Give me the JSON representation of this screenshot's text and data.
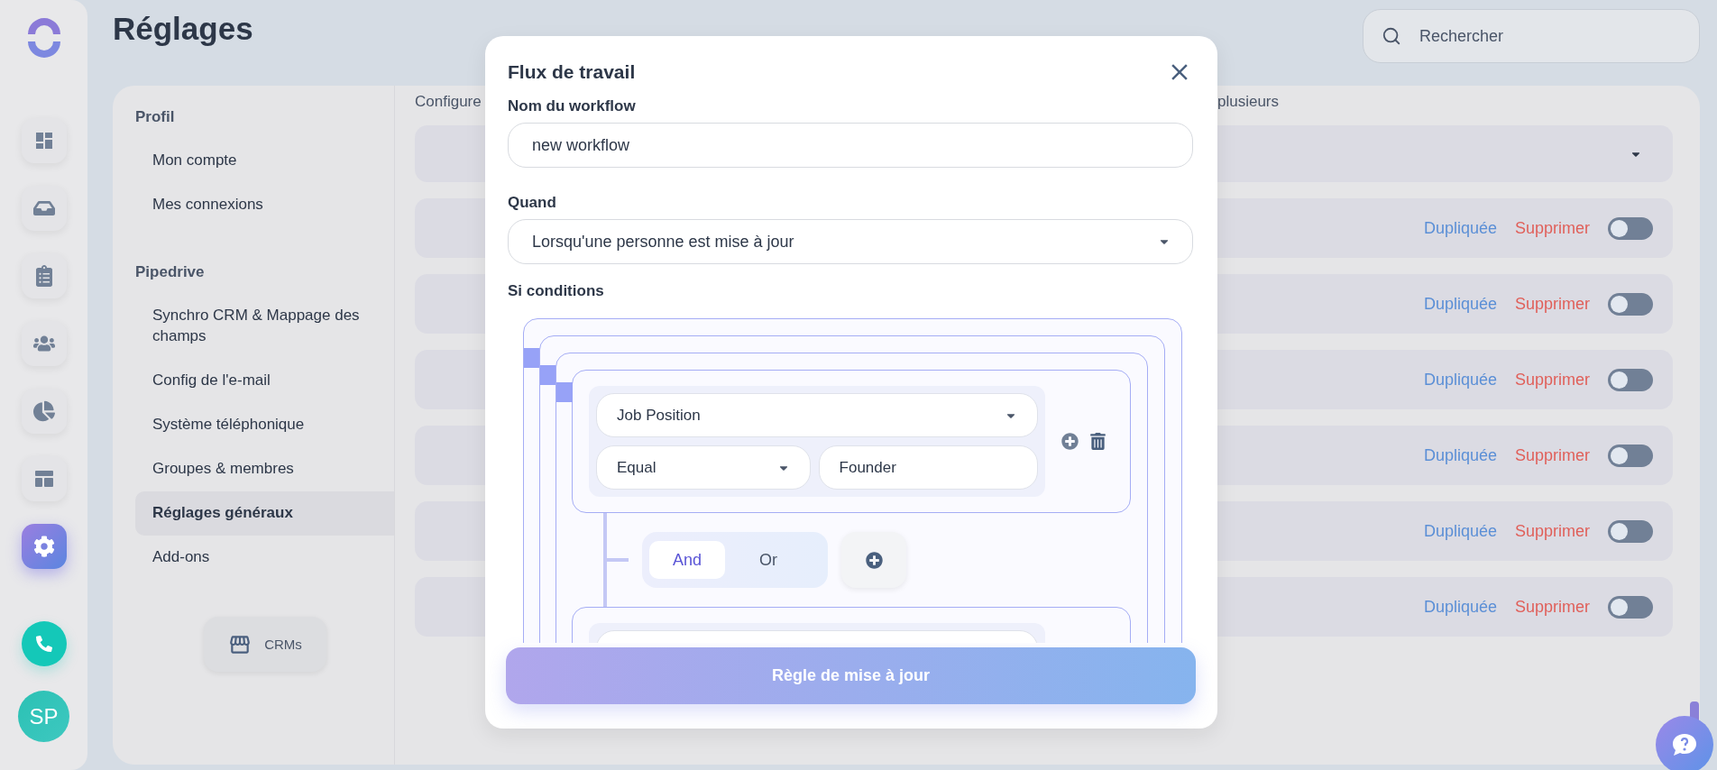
{
  "nav_rail": {
    "items": [
      {
        "selected": false
      },
      {
        "selected": false
      },
      {
        "selected": false
      },
      {
        "selected": false
      },
      {
        "selected": false
      },
      {
        "selected": false
      },
      {
        "selected": true
      }
    ],
    "avatar": "SP"
  },
  "page_title": "Réglages",
  "search": {
    "placeholder": "Rechercher"
  },
  "settings_nav": {
    "sections": [
      {
        "title": "Profil",
        "items": [
          {
            "label": "Mon compte",
            "selected": false
          },
          {
            "label": "Mes connexions",
            "selected": false
          }
        ]
      },
      {
        "title": "Pipedrive",
        "items": [
          {
            "label": "Synchro CRM & Mappage des champs",
            "selected": false
          },
          {
            "label": "Config de l'e-mail",
            "selected": false
          },
          {
            "label": "Système téléphonique",
            "selected": false
          },
          {
            "label": "Groupes & membres",
            "selected": false
          },
          {
            "label": "Réglages généraux",
            "selected": true
          },
          {
            "label": "Add-ons",
            "selected": false
          }
        ]
      }
    ],
    "crms_button": "CRMs"
  },
  "content": {
    "description_start": "Configure",
    "description_end": "plusieurs",
    "workflows": [
      {
        "duplicate": "Dupliquée",
        "delete": "Supprimer",
        "on": false
      },
      {
        "duplicate": "Dupliquée",
        "delete": "Supprimer",
        "on": false
      },
      {
        "duplicate": "Dupliquée",
        "delete": "Supprimer",
        "on": false
      },
      {
        "duplicate": "Dupliquée",
        "delete": "Supprimer",
        "on": false
      },
      {
        "duplicate": "Dupliquée",
        "delete": "Supprimer",
        "on": false
      },
      {
        "duplicate": "Dupliquée",
        "delete": "Supprimer",
        "on": false
      }
    ]
  },
  "modal": {
    "title": "Flux de travail",
    "name_label": "Nom du workflow",
    "name_value": "new workflow",
    "when_label": "Quand",
    "when_value": "Lorsqu'une personne est mise à jour",
    "conditions_label": "Si conditions",
    "conditions": {
      "kind": "group",
      "children": [
        {
          "kind": "group",
          "children": [
            {
              "kind": "group",
              "children": [
                {
                  "kind": "rule",
                  "field": "Job Position",
                  "operator": "Equal",
                  "value": "Founder"
                },
                {
                  "kind": "join",
                  "options": [
                    {
                      "label": "And",
                      "selected": true
                    },
                    {
                      "label": "Or",
                      "selected": false
                    }
                  ]
                },
                {
                  "kind": "rule"
                }
              ]
            }
          ]
        }
      ]
    },
    "submit": "Règle de mise à jour"
  }
}
